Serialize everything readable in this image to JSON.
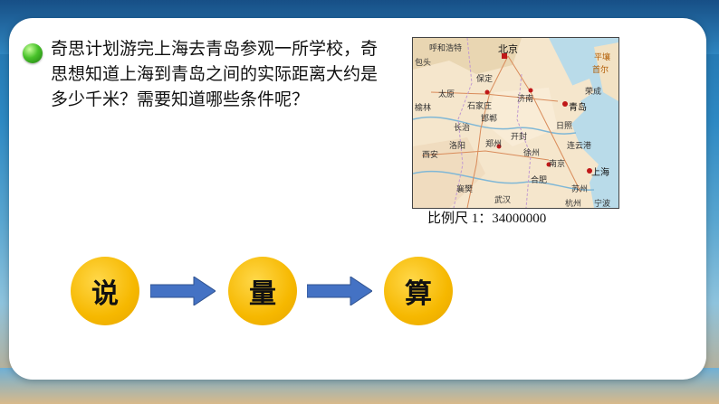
{
  "question": {
    "text": "奇思计划游完上海去青岛参观一所学校，奇思想知道上海到青岛之间的实际距离大约是多少千米？需要知道哪些条件呢？"
  },
  "map": {
    "labels": [
      "北京",
      "保定",
      "太原",
      "石家庄",
      "济南",
      "青岛",
      "邯郸",
      "长治",
      "郑州",
      "开封",
      "西安",
      "襄樊",
      "武汉",
      "合肥",
      "南京",
      "连云港",
      "上海",
      "杭州",
      "宁波",
      "平壤",
      "首尔",
      "荣成",
      "呼和浩特",
      "包头",
      "榆林",
      "洛阳",
      "徐州",
      "苏州",
      "日照"
    ]
  },
  "scale": {
    "text": "比例尺 1：34000000"
  },
  "steps": {
    "items": [
      "说",
      "量",
      "算"
    ],
    "arrow_color": "#4472c4"
  }
}
